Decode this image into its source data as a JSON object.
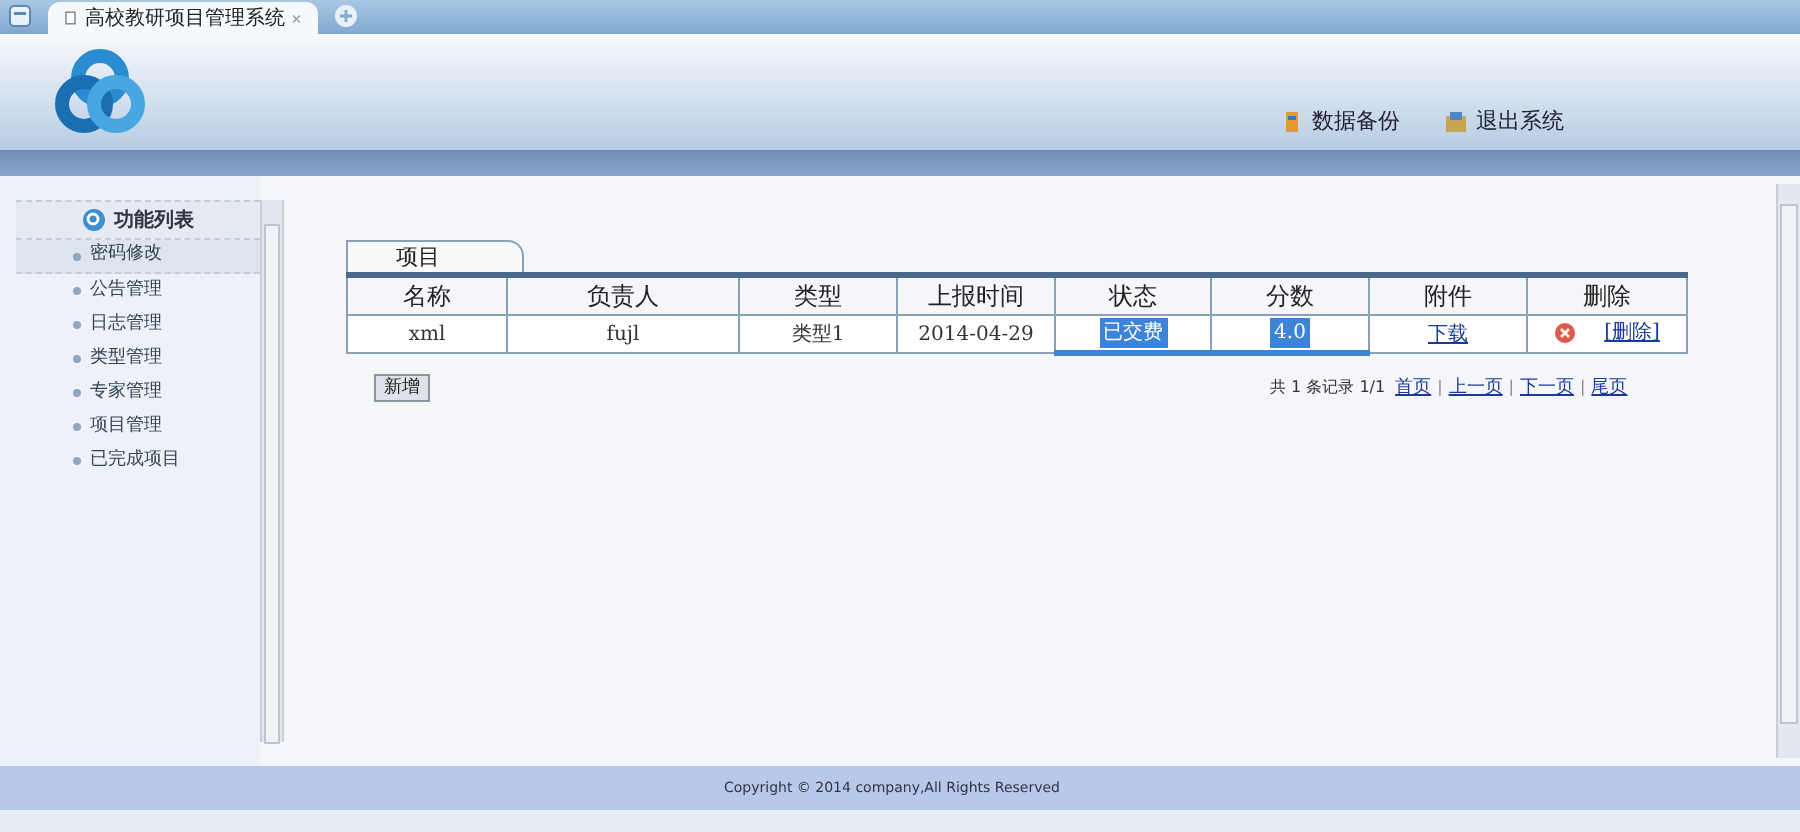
{
  "browser_tab": {
    "title": "高校教研项目管理系统"
  },
  "header_links": [
    {
      "label": "数据备份",
      "kind": "backup"
    },
    {
      "label": "退出系统",
      "kind": "exit"
    }
  ],
  "sidebar": {
    "title": "功能列表",
    "items": [
      {
        "label": "密码修改",
        "selected": true
      },
      {
        "label": "公告管理",
        "selected": false
      },
      {
        "label": "日志管理",
        "selected": false
      },
      {
        "label": "类型管理",
        "selected": false
      },
      {
        "label": "专家管理",
        "selected": false
      },
      {
        "label": "项目管理",
        "selected": false
      },
      {
        "label": "已完成项目",
        "selected": false
      }
    ]
  },
  "panel_tab": "项目",
  "table": {
    "columns": [
      "名称",
      "负责人",
      "类型",
      "上报时间",
      "状态",
      "分数",
      "附件",
      "删除"
    ],
    "rows": [
      [
        {
          "text": "xml",
          "kind": "text",
          "highlighted": false
        },
        {
          "text": "fujl",
          "kind": "text",
          "highlighted": false
        },
        {
          "text": "类型1",
          "kind": "text",
          "highlighted": false
        },
        {
          "text": "2014-04-29",
          "kind": "text",
          "highlighted": false
        },
        {
          "text": "已交费",
          "kind": "text",
          "highlighted": true
        },
        {
          "text": "4.0",
          "kind": "text",
          "highlighted": true
        },
        {
          "text": "下载",
          "kind": "link",
          "highlighted": false
        },
        {
          "text": "[删除]",
          "kind": "delete",
          "highlighted": false
        }
      ]
    ]
  },
  "add_button": "新增",
  "pagination": {
    "summary": "共 1 条记录 1/1",
    "links": [
      "首页",
      "上一页",
      "下一页",
      "尾页"
    ],
    "separator": "|"
  },
  "footer": "Copyright © 2014 company,All Rights Reserved"
}
